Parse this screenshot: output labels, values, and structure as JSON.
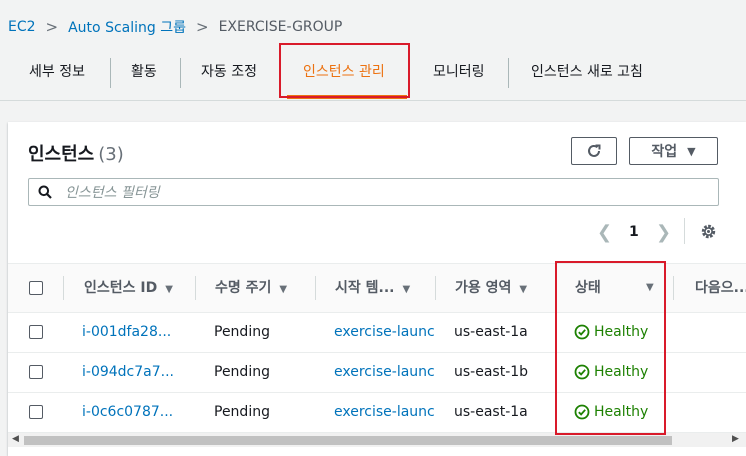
{
  "breadcrumb": {
    "ec2": "EC2",
    "asg": "Auto Scaling 그룹",
    "current": "EXERCISE-GROUP"
  },
  "tabs": {
    "details": "세부 정보",
    "activity": "활동",
    "scaling": "자동 조정",
    "instances": "인스턴스 관리",
    "monitoring": "모니터링",
    "refresh": "인스턴스 새로 고침"
  },
  "panel": {
    "title": "인스턴스",
    "count": "(3)",
    "actions_label": "작업",
    "filter_placeholder": "인스턴스 필터링",
    "page": "1"
  },
  "columns": {
    "instance_id": "인스턴스 ID",
    "lifecycle": "수명 주기",
    "launch_template": "시작 템...",
    "az": "가용 영역",
    "status": "상태",
    "next": "다음으..."
  },
  "rows": [
    {
      "id": "i-001dfa28...",
      "lifecycle": "Pending",
      "template": "exercise-launch-",
      "az": "us-east-1a",
      "status": "Healthy"
    },
    {
      "id": "i-094dc7a7...",
      "lifecycle": "Pending",
      "template": "exercise-launch-",
      "az": "us-east-1b",
      "status": "Healthy"
    },
    {
      "id": "i-0c6c0787...",
      "lifecycle": "Pending",
      "template": "exercise-launch-",
      "az": "us-east-1a",
      "status": "Healthy"
    }
  ],
  "colors": {
    "accent": "#ec7211",
    "link": "#0073bb",
    "healthy": "#1d8102",
    "highlight": "#d91a2a"
  },
  "icons": {
    "refresh": "refresh-icon",
    "search": "search-icon",
    "settings": "gear-icon",
    "healthy": "check-circle-icon"
  }
}
